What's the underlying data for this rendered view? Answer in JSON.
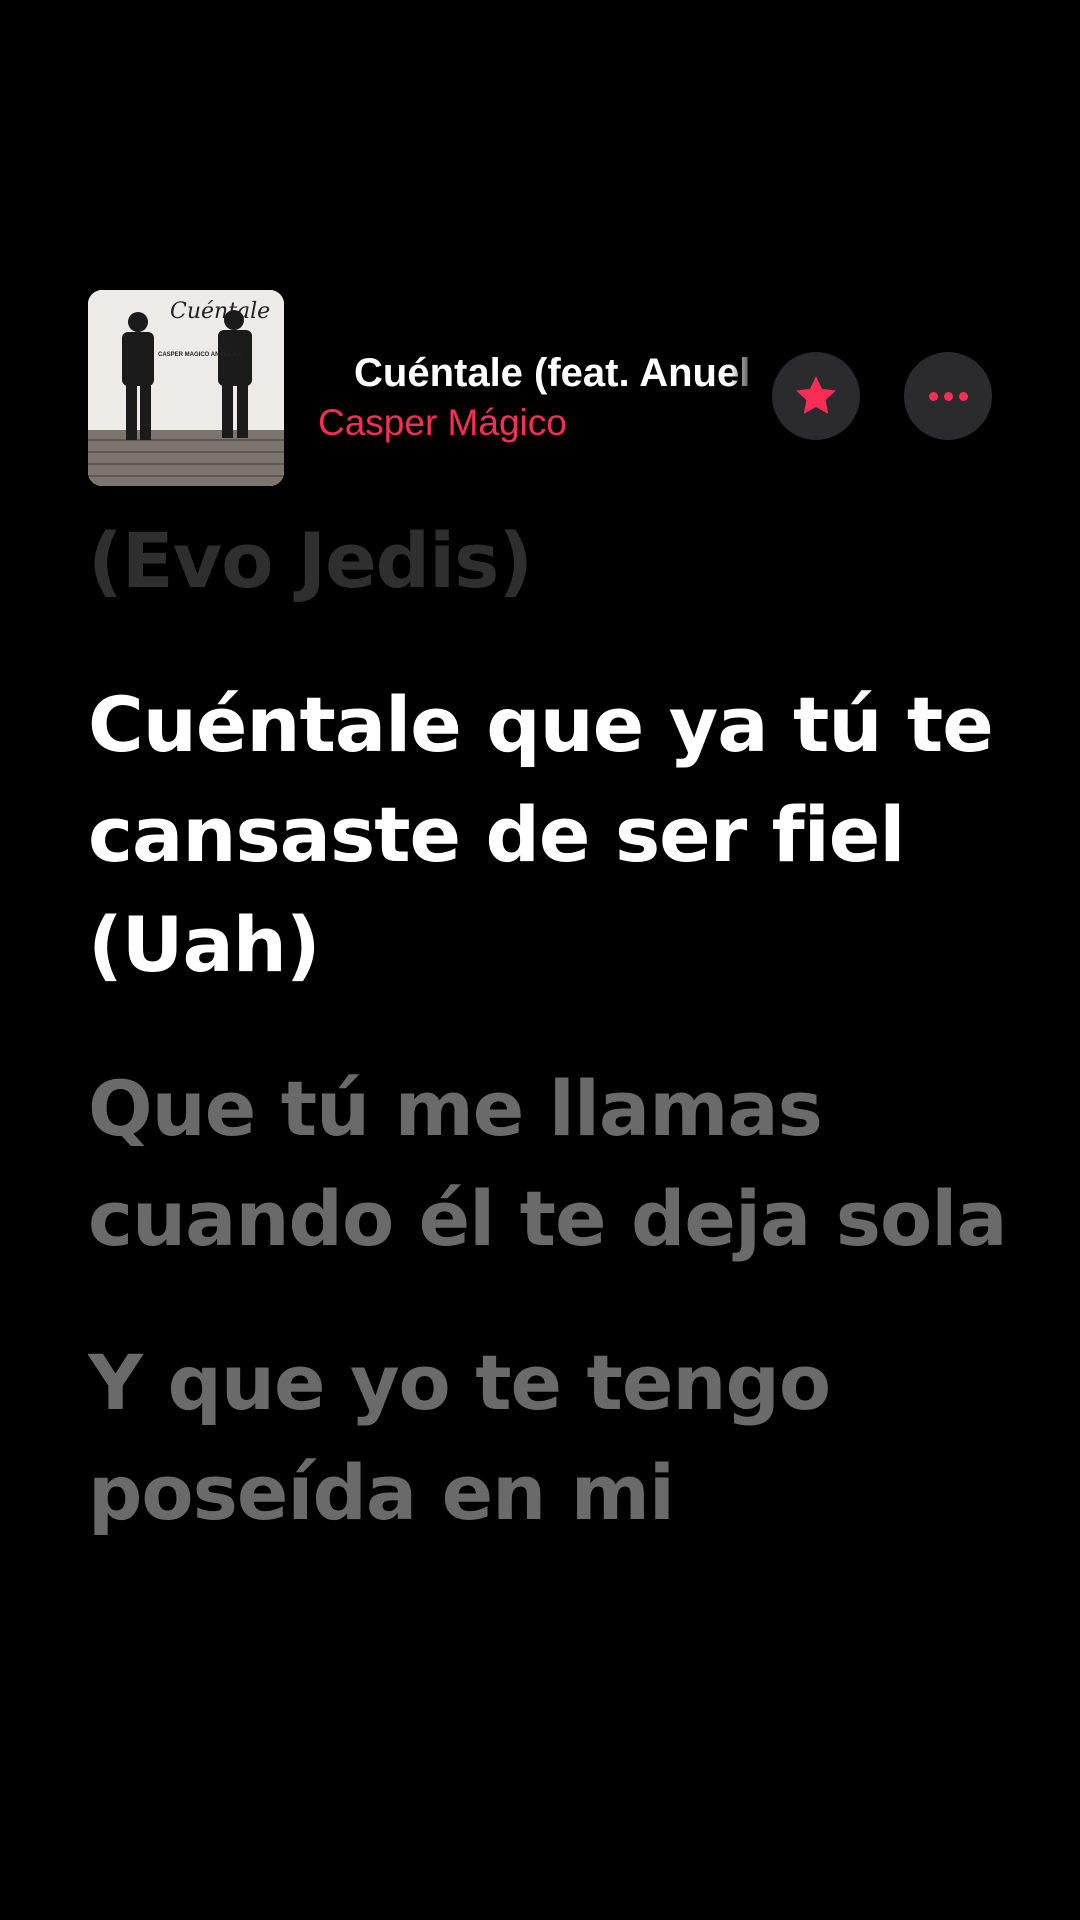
{
  "player": {
    "song_title": "Cuéntale (feat. Anuel AA)",
    "artist": "Casper Mágico",
    "artwork": {
      "title_text": "Cuéntale",
      "credit_text": "CASPER MAGICO ANUEL AA"
    },
    "favorite_icon": "star-icon",
    "more_icon": "ellipsis-icon"
  },
  "lyrics": {
    "previous": "(Evo Jedis)",
    "current": "Cuéntale que ya tú te cansaste de ser fiel (Uah)",
    "next": [
      "Que tú me llamas cuando él te deja sola",
      "Y que yo te tengo poseída en mi"
    ]
  },
  "colors": {
    "background": "#000000",
    "accent": "#fa2d55",
    "lyric_active": "#ffffff",
    "lyric_upcoming": "#6a6a6a",
    "lyric_past": "#2f2f2f"
  }
}
